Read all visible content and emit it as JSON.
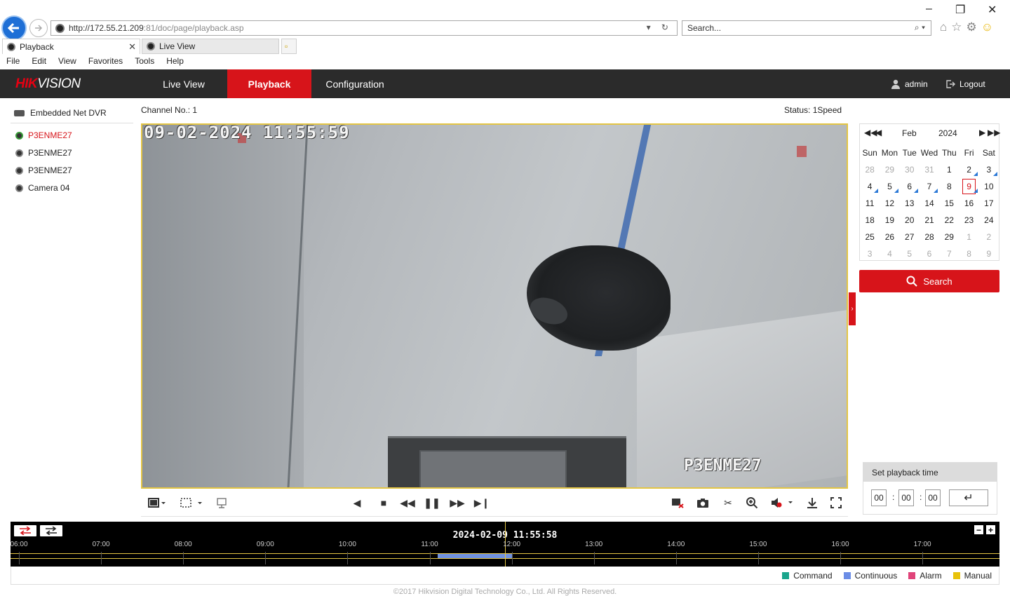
{
  "browser": {
    "url_main": "http://172.55.21.209",
    "url_rest": ":81/doc/page/playback.asp",
    "search_placeholder": "Search...",
    "tabs": [
      {
        "label": "Playback",
        "active": true
      },
      {
        "label": "Live View",
        "active": false
      }
    ],
    "menu": [
      "File",
      "Edit",
      "View",
      "Favorites",
      "Tools",
      "Help"
    ]
  },
  "app": {
    "logo_red": "HIK",
    "logo_white": "VISION",
    "nav": [
      "Live View",
      "Playback",
      "Configuration"
    ],
    "active_nav": "Playback",
    "user": "admin",
    "logout": "Logout"
  },
  "tree": {
    "root": "Embedded Net DVR",
    "cameras": [
      {
        "label": "P3ENME27",
        "active": true
      },
      {
        "label": "P3ENME27",
        "active": false
      },
      {
        "label": "P3ENME27",
        "active": false
      },
      {
        "label": "Camera 04",
        "active": false
      }
    ]
  },
  "player": {
    "channel": "Channel No.: 1",
    "status": "Status: 1Speed",
    "osd_time": "09-02-2024 11:55:59",
    "osd_name": "P3ENME27"
  },
  "calendar": {
    "month": "Feb",
    "year": "2024",
    "weekdays": [
      "Sun",
      "Mon",
      "Tue",
      "Wed",
      "Thu",
      "Fri",
      "Sat"
    ],
    "days": [
      {
        "d": "28",
        "other": true
      },
      {
        "d": "29",
        "other": true
      },
      {
        "d": "30",
        "other": true
      },
      {
        "d": "31",
        "other": true
      },
      {
        "d": "1"
      },
      {
        "d": "2",
        "rec": true
      },
      {
        "d": "3",
        "rec": true
      },
      {
        "d": "4",
        "rec": true
      },
      {
        "d": "5",
        "rec": true
      },
      {
        "d": "6",
        "rec": true
      },
      {
        "d": "7",
        "rec": true
      },
      {
        "d": "8"
      },
      {
        "d": "9",
        "sel": true,
        "rec": true
      },
      {
        "d": "10"
      },
      {
        "d": "11"
      },
      {
        "d": "12"
      },
      {
        "d": "13"
      },
      {
        "d": "14"
      },
      {
        "d": "15"
      },
      {
        "d": "16"
      },
      {
        "d": "17"
      },
      {
        "d": "18"
      },
      {
        "d": "19"
      },
      {
        "d": "20"
      },
      {
        "d": "21"
      },
      {
        "d": "22"
      },
      {
        "d": "23"
      },
      {
        "d": "24"
      },
      {
        "d": "25"
      },
      {
        "d": "26"
      },
      {
        "d": "27"
      },
      {
        "d": "28"
      },
      {
        "d": "29"
      },
      {
        "d": "1",
        "other": true
      },
      {
        "d": "2",
        "other": true
      },
      {
        "d": "3",
        "other": true
      },
      {
        "d": "4",
        "other": true
      },
      {
        "d": "5",
        "other": true
      },
      {
        "d": "6",
        "other": true
      },
      {
        "d": "7",
        "other": true
      },
      {
        "d": "8",
        "other": true
      },
      {
        "d": "9",
        "other": true
      }
    ],
    "search_label": "Search"
  },
  "playback_time": {
    "title": "Set playback time",
    "hh": "00",
    "mm": "00",
    "ss": "00"
  },
  "timeline": {
    "current": "2024-02-09 11:55:58",
    "hours": [
      "06:00",
      "07:00",
      "08:00",
      "09:00",
      "10:00",
      "11:00",
      "12:00",
      "13:00",
      "14:00",
      "15:00",
      "16:00",
      "17:00"
    ],
    "recording_from_hour": 11.1,
    "recording_to_hour": 12.0
  },
  "legend": [
    {
      "label": "Command",
      "color": "#1aa58c"
    },
    {
      "label": "Continuous",
      "color": "#6b8de6"
    },
    {
      "label": "Alarm",
      "color": "#e0447a"
    },
    {
      "label": "Manual",
      "color": "#e8c20a"
    }
  ],
  "footer": "©2017 Hikvision Digital Technology Co., Ltd. All Rights Reserved."
}
